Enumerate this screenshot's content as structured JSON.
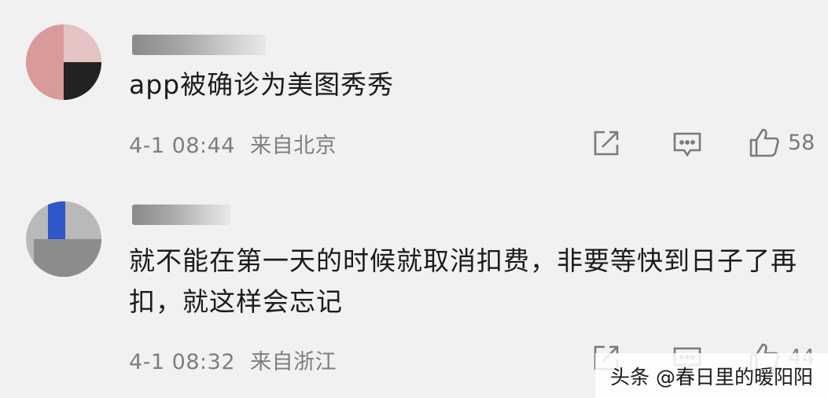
{
  "comments": [
    {
      "text": "app被确诊为美图秀秀",
      "date": "4-1 08:44",
      "location": "来自北京",
      "likes": "58"
    },
    {
      "text": "就不能在第一天的时候就取消扣费，非要等快到日子了再扣，就这样会忘记",
      "date": "4-1 08:32",
      "location": "来自浙江",
      "likes": "44"
    }
  ],
  "icons": {
    "share": "share-icon",
    "reply": "comment-icon",
    "like": "thumbs-up-icon"
  },
  "watermark": "头条 @春日里的暖阳阳",
  "colors": {
    "background": "#f1f1f1",
    "meta_text": "#7e7e7e",
    "icon": "#7a7a7a"
  }
}
